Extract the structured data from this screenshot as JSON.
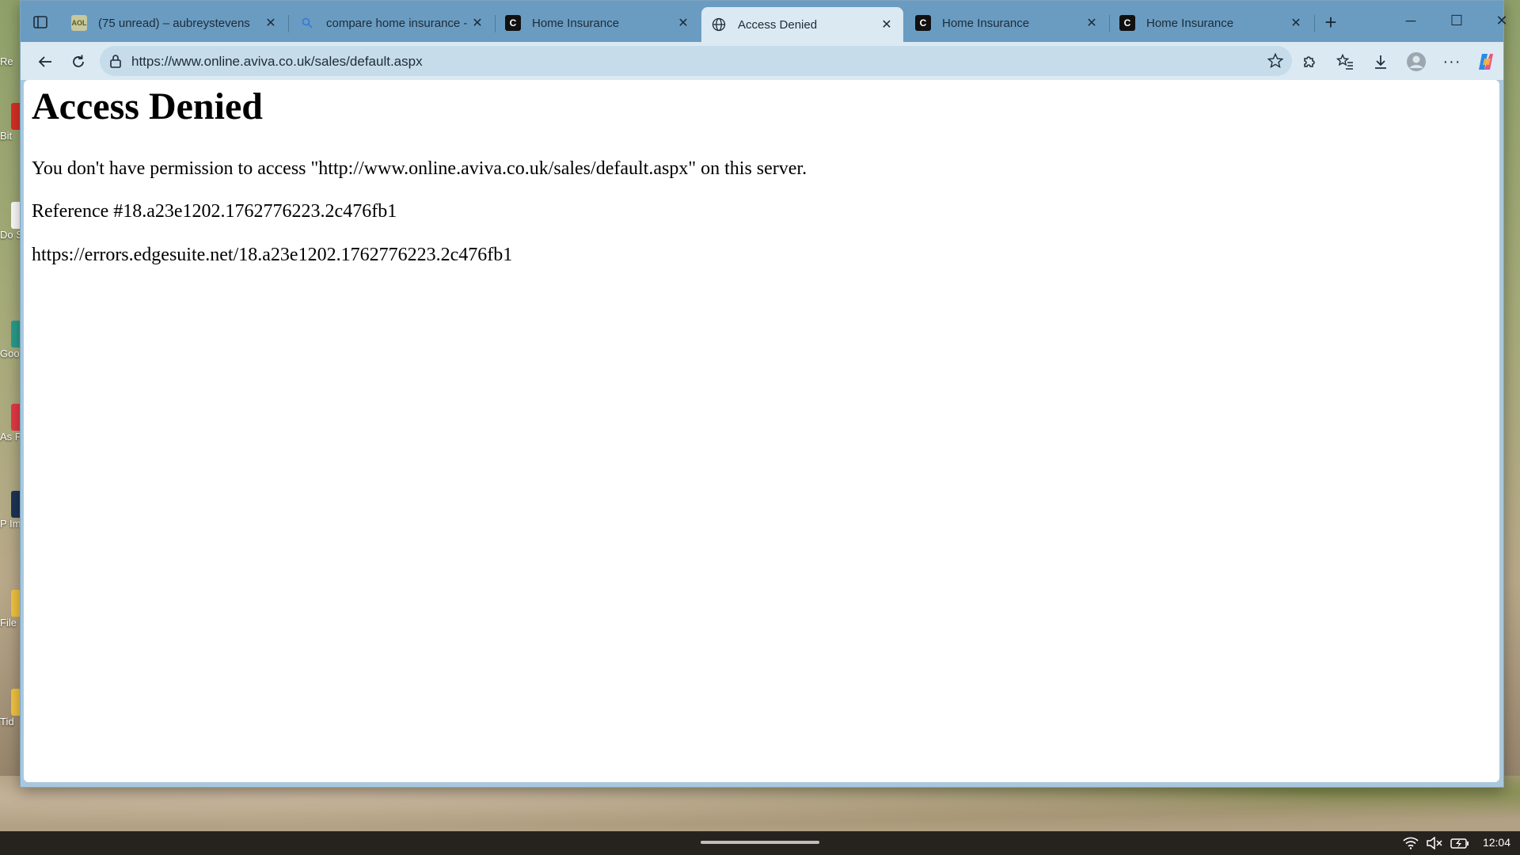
{
  "browser": {
    "tabs": [
      {
        "title": "(75 unread) – aubreystevens",
        "favicon": "aol-icon",
        "favicon_color": "#c7c89b"
      },
      {
        "title": "compare home insurance -",
        "favicon": "search-icon",
        "favicon_color": "#3a7bd5"
      },
      {
        "title": "Home Insurance",
        "favicon": "compare-icon",
        "favicon_color": "#111111"
      },
      {
        "title": "Access Denied",
        "favicon": "globe-icon",
        "favicon_color": "#1d2b36",
        "active": true
      },
      {
        "title": "Home Insurance",
        "favicon": "compare-icon",
        "favicon_color": "#111111"
      },
      {
        "title": "Home Insurance",
        "favicon": "compare-icon",
        "favicon_color": "#111111"
      }
    ],
    "address_url": "https://www.online.aviva.co.uk/sales/default.aspx",
    "accent_color": "#6a9cc2"
  },
  "page": {
    "heading": "Access Denied",
    "message": "You don't have permission to access \"http://www.online.aviva.co.uk/sales/default.aspx\" on this server.",
    "reference": "Reference #18.a23e1202.1762776223.2c476fb1",
    "error_link": "https://errors.edgesuite.net/18.a23e1202.1762776223.2c476fb1"
  },
  "desktop": {
    "icons": [
      {
        "label": "Re",
        "color": ""
      },
      {
        "label": "Bit",
        "color": "#d93025"
      },
      {
        "label": "Do S",
        "color": "#ffffff"
      },
      {
        "label": "Goo",
        "color": "#2a9d8f"
      },
      {
        "label": "As P",
        "color": "#e63946"
      },
      {
        "label": "P Ima",
        "color": "#1d3557"
      },
      {
        "label": "File",
        "color": "#f4c542"
      },
      {
        "label": "Tid",
        "color": "#f4c542"
      }
    ]
  },
  "taskbar": {
    "clock": "12:04"
  }
}
